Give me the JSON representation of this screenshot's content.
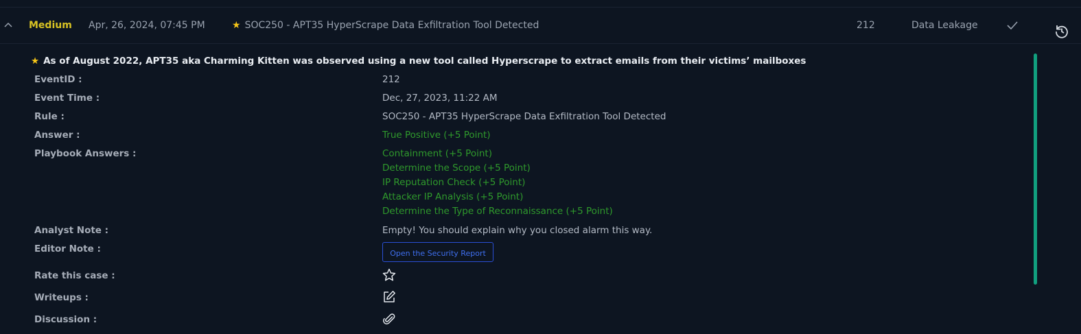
{
  "row": {
    "severity": "Medium",
    "date": "Apr, 26, 2024, 07:45 PM",
    "rule": "SOC250 - APT35 HyperScrape Data Exfiltration Tool Detected",
    "event_id": "212",
    "type": "Data Leakage"
  },
  "detail": {
    "description": "As of August 2022, APT35 aka Charming Kitten was observed using a new tool called Hyperscrape to extract emails from their victims’ mailboxes",
    "labels": {
      "event_id": "EventID :",
      "event_time": "Event Time :",
      "rule": "Rule :",
      "answer": "Answer :",
      "playbook": "Playbook Answers :",
      "analyst_note": "Analyst Note :",
      "editor_note": "Editor Note :",
      "rate": "Rate this case :",
      "writeups": "Writeups :",
      "discussion": "Discussion :"
    },
    "values": {
      "event_id": "212",
      "event_time": "Dec, 27, 2023, 11:22 AM",
      "rule": "SOC250 - APT35 HyperScrape Data Exfiltration Tool Detected",
      "answer": "True Positive (+5 Point)",
      "playbook": [
        "Containment (+5 Point)",
        "Determine the Scope (+5 Point)",
        "IP Reputation Check (+5 Point)",
        "Attacker IP Analysis (+5 Point)",
        "Determine the Type of Reconnaissance (+5 Point)"
      ],
      "analyst_note": "Empty! You should explain why you closed alarm this way.",
      "report_button": "Open the Security Report"
    }
  },
  "colors": {
    "background": "#0d1521",
    "severity_medium": "#d9c323",
    "positive_green": "#2f9a2c",
    "button_blue": "#3f6ff0",
    "scrollbar": "#11a07f"
  }
}
